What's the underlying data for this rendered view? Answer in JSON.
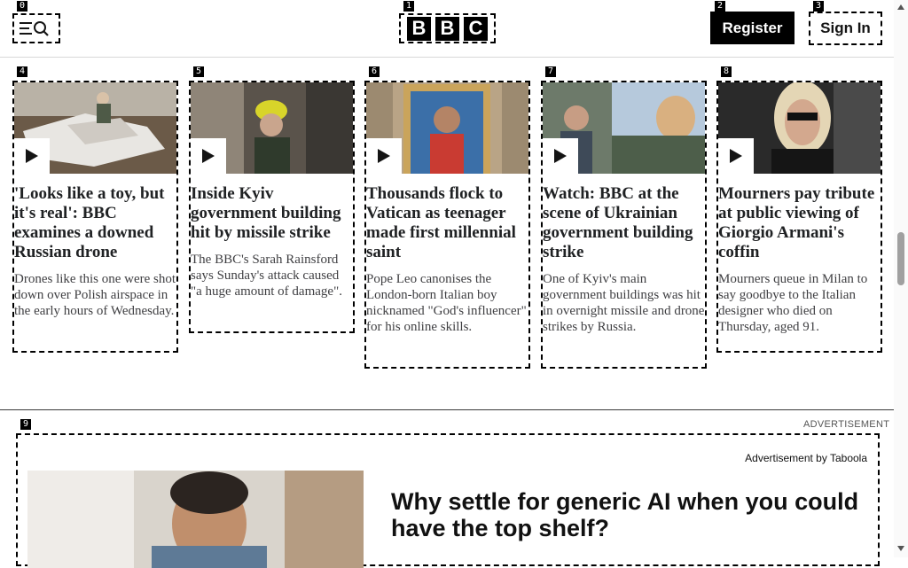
{
  "header": {
    "markers": [
      "0",
      "1",
      "2",
      "3"
    ],
    "logo_letters": [
      "B",
      "B",
      "C"
    ],
    "register_label": "Register",
    "signin_label": "Sign In"
  },
  "cards": [
    {
      "marker": "4",
      "title": "'Looks like a toy, but it's real': BBC examines a downed Russian drone",
      "summary": "Drones like this one were shot down over Polish airspace in the early hours of Wednesday."
    },
    {
      "marker": "5",
      "title": "Inside Kyiv government building hit by missile strike",
      "summary": "The BBC's Sarah Rainsford says Sunday's attack caused \"a huge amount of damage\"."
    },
    {
      "marker": "6",
      "title": "Thousands flock to Vatican as teenager made first millennial saint",
      "summary": "Pope Leo canonises the London-born Italian boy nicknamed \"God's influencer\" for his online skills."
    },
    {
      "marker": "7",
      "title": "Watch: BBC at the scene of Ukrainian government building strike",
      "summary": "One of Kyiv's main government buildings was hit in overnight missile and drone strikes by Russia."
    },
    {
      "marker": "8",
      "title": "Mourners pay tribute at public viewing of Giorgio Armani's coffin",
      "summary": "Mourners queue in Milan to say goodbye to the Italian designer who died on Thursday, aged 91."
    }
  ],
  "ad": {
    "marker": "9",
    "label": "ADVERTISEMENT",
    "by": "Advertisement by Taboola",
    "title": "Why settle for generic AI when you could have the top shelf?"
  },
  "colors": {
    "text": "#202224",
    "button_bg": "#000000"
  }
}
